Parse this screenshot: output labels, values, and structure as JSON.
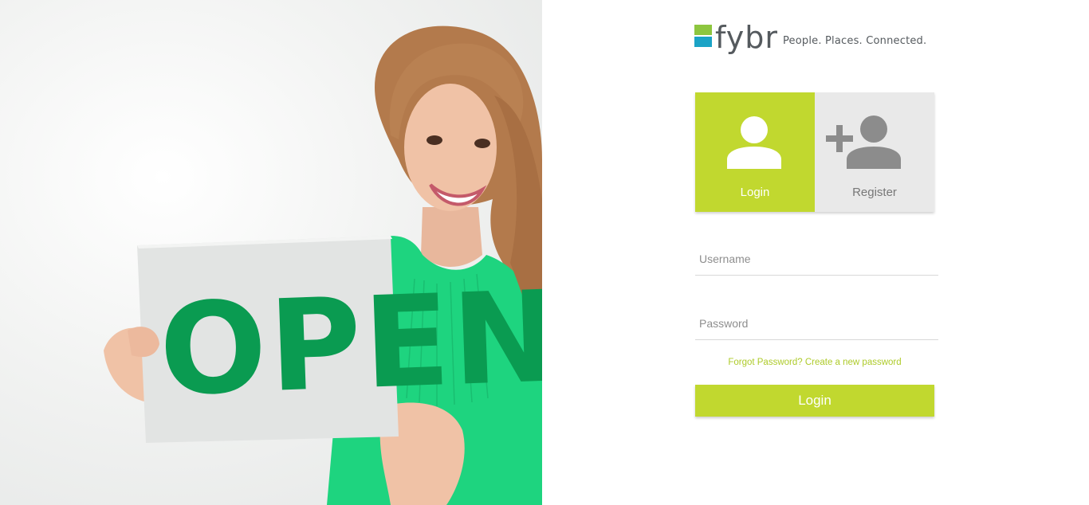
{
  "hero": {
    "sign_text": "OPEN",
    "image": "woman-holding-open-sign",
    "colors": {
      "sign_text": "#0a9b51",
      "dress": "#1ed47f",
      "hair": "#b37a4c"
    }
  },
  "brand": {
    "name": "fybr",
    "tagline": "People. Places. Connected.",
    "colors": {
      "mark_green": "#8dc63f",
      "mark_blue": "#1ba3c6",
      "wordmark": "#555a5e"
    }
  },
  "tabs": [
    {
      "label": "Login",
      "icon": "user-icon",
      "active": true
    },
    {
      "label": "Register",
      "icon": "add-user-icon",
      "active": false
    }
  ],
  "form": {
    "username": {
      "placeholder": "Username",
      "value": ""
    },
    "password": {
      "placeholder": "Password",
      "value": ""
    },
    "forgot_link": "Forgot Password? Create a new password",
    "submit_label": "Login"
  },
  "colors": {
    "accent": "#c1d82f",
    "inactive_tab": "#e9e9e9",
    "link": "#aecb2a"
  }
}
